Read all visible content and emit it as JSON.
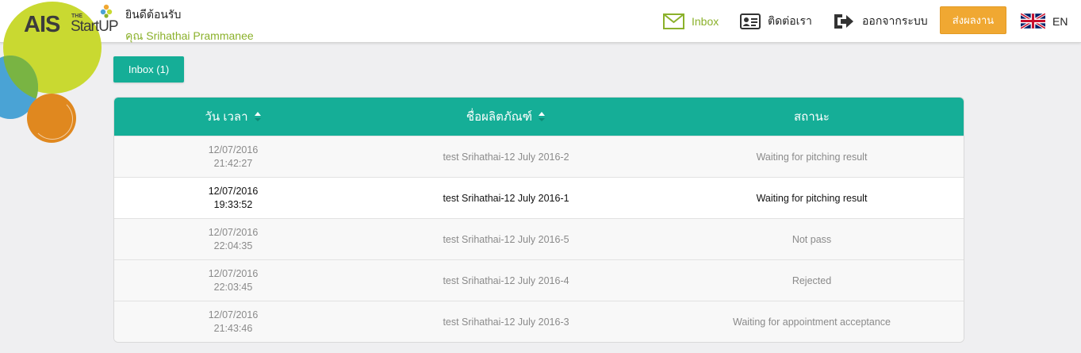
{
  "header": {
    "logo_ais": "AIS",
    "logo_the": "THE",
    "logo_startup": "StartUP",
    "welcome": "ยินดีต้อนรับ",
    "user_name": "คุณ Srihathai Prammanee"
  },
  "nav": {
    "inbox": "Inbox",
    "contact": "ติดต่อเรา",
    "logout": "ออกจากระบบ",
    "submit": "ส่งผลงาน",
    "language": "EN"
  },
  "tab": {
    "label": "Inbox (1)"
  },
  "table": {
    "columns": [
      "วัน เวลา",
      "ชื่อผลิตภัณฑ์",
      "สถานะ"
    ],
    "rows": [
      {
        "date": "12/07/2016",
        "time": "21:42:27",
        "product": "test Srihathai-12 July 2016-2",
        "status": "Waiting for pitching result"
      },
      {
        "date": "12/07/2016",
        "time": "19:33:52",
        "product": "test Srihathai-12 July 2016-1",
        "status": "Waiting for pitching result"
      },
      {
        "date": "12/07/2016",
        "time": "22:04:35",
        "product": "test Srihathai-12 July 2016-5",
        "status": "Not pass"
      },
      {
        "date": "12/07/2016",
        "time": "22:03:45",
        "product": "test Srihathai-12 July 2016-4",
        "status": "Rejected"
      },
      {
        "date": "12/07/2016",
        "time": "21:43:46",
        "product": "test Srihathai-12 July 2016-3",
        "status": "Waiting for appointment acceptance"
      }
    ]
  },
  "colors": {
    "teal": "#15ae97",
    "green_accent": "#8bb12b",
    "orange_button": "#f0a832"
  },
  "icons": {
    "inbox": "envelope-icon",
    "contact": "contact-card-icon",
    "logout": "logout-arrow-icon",
    "language": "uk-flag-icon",
    "sort": "sort-caret-icon"
  }
}
